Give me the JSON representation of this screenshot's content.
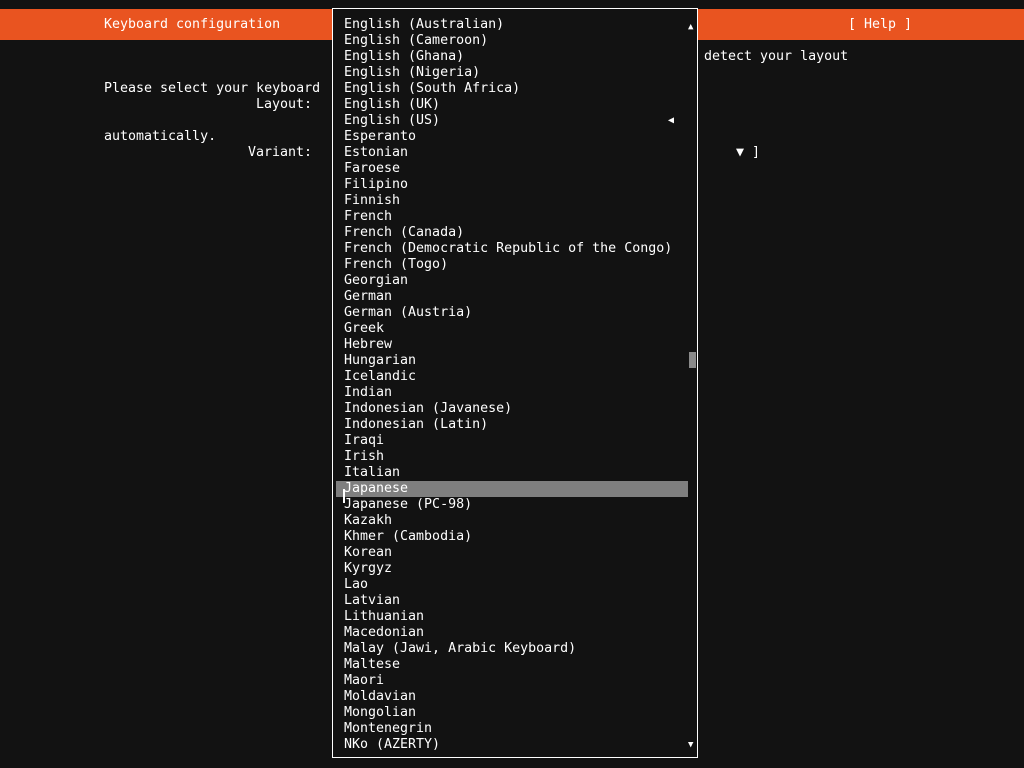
{
  "header": {
    "title": "Keyboard configuration",
    "help": "[ Help ]"
  },
  "intro": {
    "line1_start": "Please select your keyboard",
    "line1_end": "detect your layout",
    "line2": "automatically."
  },
  "form": {
    "layout_label": "Layout:",
    "variant_label": "Variant:",
    "variant_tail": "▼ ]"
  },
  "dropdown": {
    "scroll_up_icon": "▲",
    "scroll_down_icon": "▼",
    "current_marker": "◀",
    "current_item": "English (US)",
    "highlighted_item": "Japanese",
    "items": [
      "English (Australian)",
      "English (Cameroon)",
      "English (Ghana)",
      "English (Nigeria)",
      "English (South Africa)",
      "English (UK)",
      "English (US)",
      "Esperanto",
      "Estonian",
      "Faroese",
      "Filipino",
      "Finnish",
      "French",
      "French (Canada)",
      "French (Democratic Republic of the Congo)",
      "French (Togo)",
      "Georgian",
      "German",
      "German (Austria)",
      "Greek",
      "Hebrew",
      "Hungarian",
      "Icelandic",
      "Indian",
      "Indonesian (Javanese)",
      "Indonesian (Latin)",
      "Iraqi",
      "Irish",
      "Italian",
      "Japanese",
      "Japanese (PC-98)",
      "Kazakh",
      "Khmer (Cambodia)",
      "Korean",
      "Kyrgyz",
      "Lao",
      "Latvian",
      "Lithuanian",
      "Macedonian",
      "Malay (Jawi, Arabic Keyboard)",
      "Maltese",
      "Maori",
      "Moldavian",
      "Mongolian",
      "Montenegrin",
      "NKo (AZERTY)"
    ]
  },
  "colors": {
    "accent": "#e95420",
    "background": "#121212",
    "highlight": "#7f7f7f"
  }
}
